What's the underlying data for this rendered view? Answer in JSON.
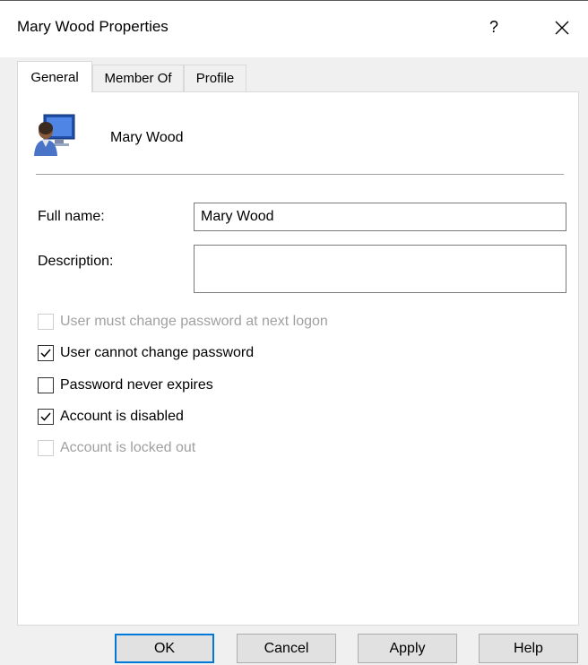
{
  "window": {
    "title": "Mary Wood Properties",
    "help_glyph": "?"
  },
  "tabs": [
    {
      "label": "General",
      "active": true
    },
    {
      "label": "Member Of",
      "active": false
    },
    {
      "label": "Profile",
      "active": false
    }
  ],
  "general": {
    "display_name": "Mary Wood",
    "avatar_icon": "user-icon",
    "full_name_label": "Full name:",
    "full_name_value": "Mary Wood",
    "description_label": "Description:",
    "description_value": ""
  },
  "options": [
    {
      "label": "User must change password at next logon",
      "checked": false,
      "enabled": false
    },
    {
      "label": "User cannot change password",
      "checked": true,
      "enabled": true
    },
    {
      "label": "Password never expires",
      "checked": false,
      "enabled": true
    },
    {
      "label": "Account is disabled",
      "checked": true,
      "enabled": true
    },
    {
      "label": "Account is locked out",
      "checked": false,
      "enabled": false
    }
  ],
  "buttons": {
    "ok": "OK",
    "cancel": "Cancel",
    "apply": "Apply",
    "help": "Help"
  },
  "colors": {
    "accent": "#0078d7",
    "disabled_text": "#a0a0a0"
  }
}
